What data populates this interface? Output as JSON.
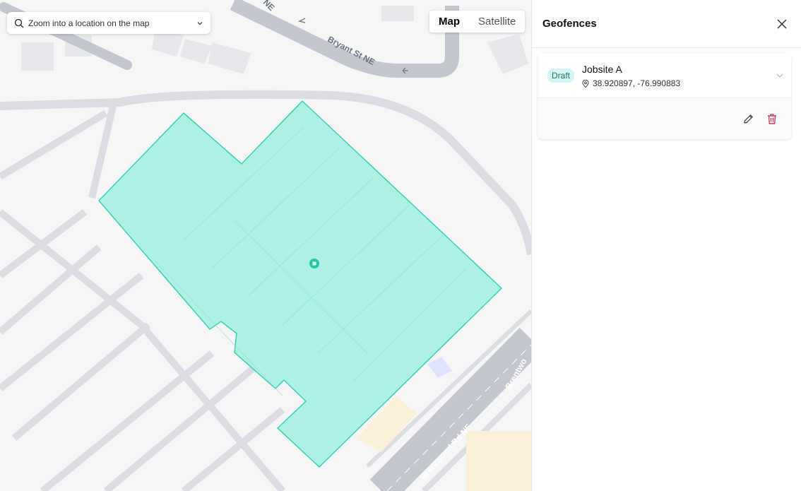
{
  "map": {
    "search_placeholder": "Zoom into a location on the map",
    "map_types": [
      "Map",
      "Satellite"
    ],
    "active_map_type": "Map",
    "road_labels": [
      "Bryant St NE",
      "Brentwood Rd NE",
      "Brentwo",
      "NE"
    ],
    "colors": {
      "geofence_fill": "#a6efe3",
      "geofence_stroke": "#2fd6b6",
      "road": "#dcdde3",
      "land": "#f6f6f7",
      "blocks": "#e6e7ea"
    }
  },
  "panel": {
    "title": "Geofences",
    "geofences": [
      {
        "status": "Draft",
        "name": "Jobsite A",
        "coordinates": "38.920897, -76.990883"
      }
    ]
  },
  "icons": {
    "search": "search-icon",
    "dropdown": "chevron-down-icon",
    "close": "close-icon",
    "location": "location-pin-icon",
    "edit": "pencil-icon",
    "delete": "trash-icon"
  }
}
